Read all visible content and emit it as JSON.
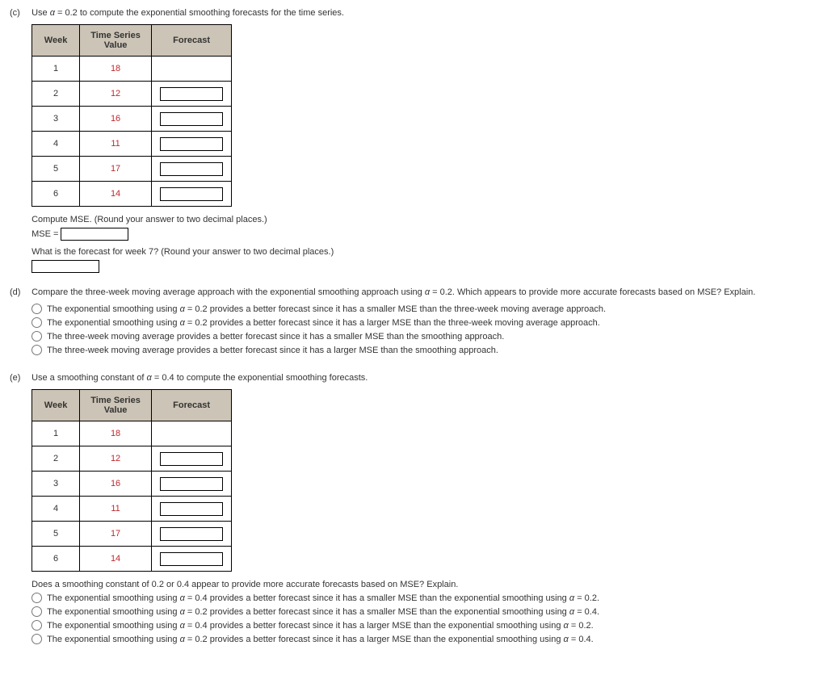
{
  "part_c": {
    "label": "(c)",
    "prompt_pre": "Use ",
    "prompt_alpha": "α",
    "prompt_mid": " = 0.2 to compute the exponential smoothing forecasts for the time series.",
    "table": {
      "headers": {
        "week": "Week",
        "ts": "Time Series Value",
        "fc": "Forecast"
      },
      "rows": [
        {
          "week": "1",
          "ts": "18",
          "has_input": false
        },
        {
          "week": "2",
          "ts": "12",
          "has_input": true
        },
        {
          "week": "3",
          "ts": "16",
          "has_input": true
        },
        {
          "week": "4",
          "ts": "11",
          "has_input": true
        },
        {
          "week": "5",
          "ts": "17",
          "has_input": true
        },
        {
          "week": "6",
          "ts": "14",
          "has_input": true
        }
      ]
    },
    "mse_prompt": "Compute MSE. (Round your answer to two decimal places.)",
    "mse_label": "MSE = ",
    "week7_prompt": "What is the forecast for week 7? (Round your answer to two decimal places.)"
  },
  "part_d": {
    "label": "(d)",
    "prompt": "Compare the three-week moving average approach with the exponential smoothing approach using α = 0.2. Which appears to provide more accurate forecasts based on MSE? Explain.",
    "choices": [
      "The exponential smoothing using α = 0.2 provides a better forecast since it has a smaller MSE than the three-week moving average approach.",
      "The exponential smoothing using α = 0.2 provides a better forecast since it has a larger MSE than the three-week moving average approach.",
      "The three-week moving average provides a better forecast since it has a smaller MSE than the smoothing approach.",
      "The three-week moving average provides a better forecast since it has a larger MSE than the smoothing approach."
    ]
  },
  "part_e": {
    "label": "(e)",
    "prompt": "Use a smoothing constant of α = 0.4 to compute the exponential smoothing forecasts.",
    "table": {
      "headers": {
        "week": "Week",
        "ts": "Time Series Value",
        "fc": "Forecast"
      },
      "rows": [
        {
          "week": "1",
          "ts": "18",
          "has_input": false
        },
        {
          "week": "2",
          "ts": "12",
          "has_input": true
        },
        {
          "week": "3",
          "ts": "16",
          "has_input": true
        },
        {
          "week": "4",
          "ts": "11",
          "has_input": true
        },
        {
          "week": "5",
          "ts": "17",
          "has_input": true
        },
        {
          "week": "6",
          "ts": "14",
          "has_input": true
        }
      ]
    },
    "compare_prompt": "Does a smoothing constant of 0.2 or 0.4 appear to provide more accurate forecasts based on MSE? Explain.",
    "choices": [
      "The exponential smoothing using α = 0.4 provides a better forecast since it has a smaller MSE than the exponential smoothing using α = 0.2.",
      "The exponential smoothing using α = 0.2 provides a better forecast since it has a smaller MSE than the exponential smoothing using α = 0.4.",
      "The exponential smoothing using α = 0.4 provides a better forecast since it has a larger MSE than the exponential smoothing using α = 0.2.",
      "The exponential smoothing using α = 0.2 provides a better forecast since it has a larger MSE than the exponential smoothing using α = 0.4."
    ]
  }
}
